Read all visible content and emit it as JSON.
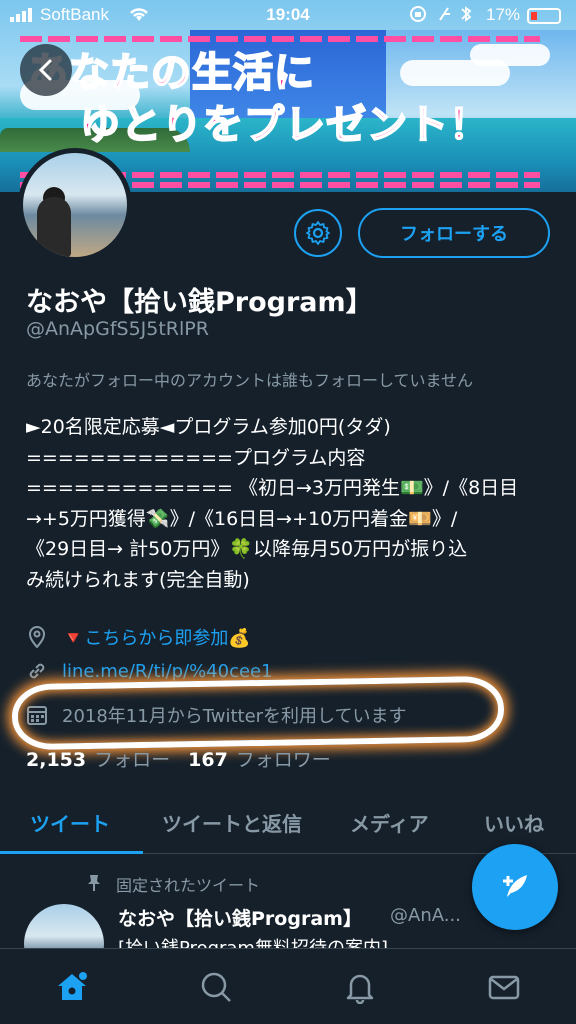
{
  "status_bar": {
    "carrier": "SoftBank",
    "time": "19:04",
    "battery": "17%"
  },
  "banner": {
    "line1": "あなたの生活に",
    "line2": "ゆとりをプレゼント！"
  },
  "profile": {
    "name": "なおや【拾い銭Program】",
    "handle": "@AnApGfS5J5tRlPR",
    "follow_label": "フォローする",
    "notice": "あなたがフォロー中のアカウントは誰もフォローしていません",
    "bio_lines": [
      "►20名限定応募◄プログラム参加0円(タダ)",
      "=============プログラム内容",
      "============= 《初日→3万円発生💵》/《8日目",
      "→+5万円獲得💸》/《16日目→+10万円着金💴》/",
      "《29日目→ 計50万円》🍀以降毎月50万円が振り込",
      "み続けられます(完全自動)"
    ],
    "location": "🔻こちらから即参加💰",
    "link": "line.me/R/ti/p/%40cee1",
    "joined": "2018年11月からTwitterを利用しています",
    "following_count": "2,153",
    "following_label": "フォロー",
    "followers_count": "167",
    "followers_label": "フォロワー"
  },
  "tabs": [
    {
      "label": "ツイート",
      "active": true
    },
    {
      "label": "ツイートと返信",
      "active": false
    },
    {
      "label": "メディア",
      "active": false
    },
    {
      "label": "いいね",
      "active": false
    }
  ],
  "pinned_tweet": {
    "pinned_label": "固定されたツイート",
    "name": "なおや【拾い銭Program】",
    "handle": "@AnA...",
    "text": "[拾い銭Program無料招待の案内]"
  },
  "icons": {
    "back": "chevron-left-icon",
    "settings": "gear-icon",
    "location": "location-pin-icon",
    "link": "link-icon",
    "calendar": "calendar-icon",
    "pin": "pin-icon",
    "compose": "compose-tweet-icon",
    "home": "home-icon",
    "search": "search-icon",
    "notifications": "bell-icon",
    "messages": "mail-icon"
  },
  "colors": {
    "background": "#15202b",
    "accent": "#1da1f2",
    "secondary_text": "#8899a6",
    "banner_text": "#ff2e93"
  }
}
